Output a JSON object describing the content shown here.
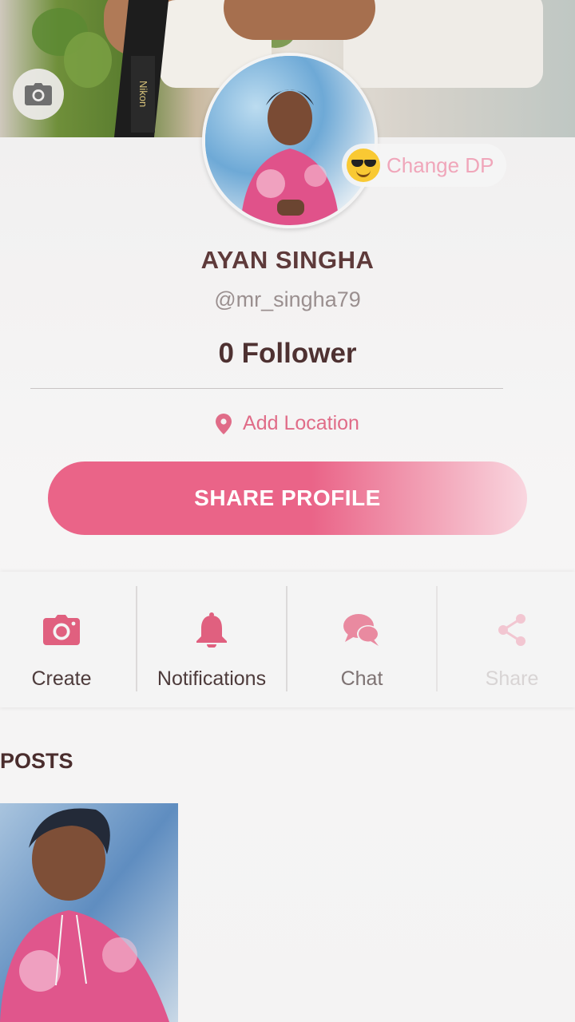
{
  "cover": {
    "camera_icon": "camera-icon",
    "strap_brand": "Nikon"
  },
  "profile": {
    "change_dp_label": "Change DP",
    "change_dp_emoji": "sunglasses-emoji",
    "name": "AYAN SINGHA",
    "username": "@mr_singha79",
    "followers": "0 Follower",
    "location_label": "Add Location",
    "location_icon": "location-pin-icon",
    "share_button_label": "SHARE PROFILE"
  },
  "actions": [
    {
      "label": "Create",
      "icon": "camera-icon"
    },
    {
      "label": "Notifications",
      "icon": "bell-icon"
    },
    {
      "label": "Chat",
      "icon": "chat-bubbles-icon"
    },
    {
      "label": "Share",
      "icon": "share-icon"
    }
  ],
  "posts": {
    "title": "POSTS"
  },
  "colors": {
    "accent": "#ea6488",
    "name": "#5e3a3a",
    "muted": "#9a8f8f"
  }
}
